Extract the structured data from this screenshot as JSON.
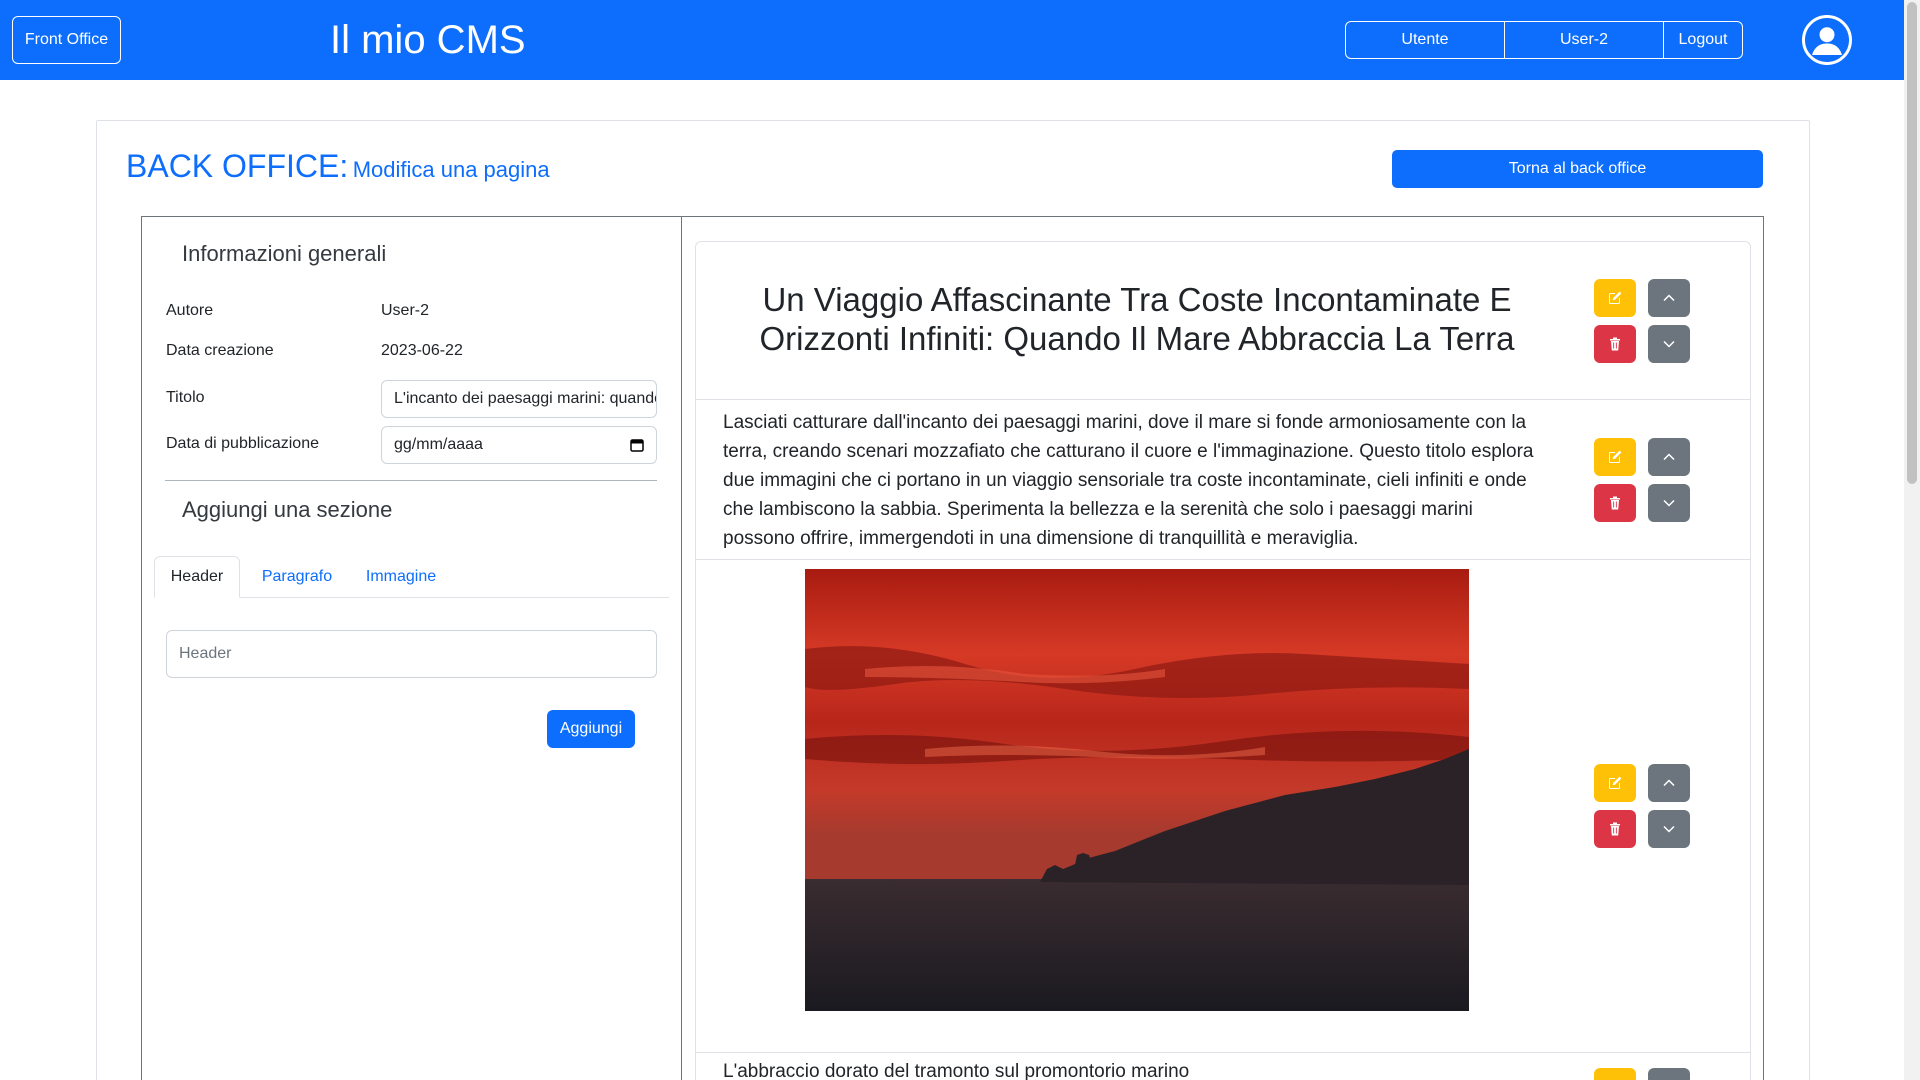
{
  "navbar": {
    "front_office_label": "Front Office",
    "brand": "Il mio CMS",
    "utente_label": "Utente",
    "user_label": "User-2",
    "logout_label": "Logout",
    "avatar_icon": "user-circle-icon"
  },
  "page": {
    "heading_main": "BACK OFFICE:",
    "heading_sub": "Modifica una pagina",
    "back_button_label": "Torna al back office"
  },
  "info": {
    "title": "Informazioni generali",
    "author_label": "Autore",
    "author_value": "User-2",
    "created_label": "Data creazione",
    "created_value": "2023-06-22",
    "title_label": "Titolo",
    "title_value": "L'incanto dei paesaggi marini: quando il mare abbraccia la terra",
    "pubdate_label": "Data di pubblicazione",
    "pubdate_placeholder": "gg/mm/aaaa"
  },
  "add_section": {
    "title": "Aggiungi una sezione",
    "tabs": [
      {
        "label": "Header",
        "active": true
      },
      {
        "label": "Paragrafo",
        "active": false
      },
      {
        "label": "Immagine",
        "active": false
      }
    ],
    "input_placeholder": "Header",
    "add_label": "Aggiungi"
  },
  "preview": {
    "header_text": "Un Viaggio Affascinante Tra Coste Incontaminate E Orizzonti Infiniti: Quando Il Mare Abbraccia La Terra",
    "paragraph_text": "Lasciati catturare dall'incanto dei paesaggi marini, dove il mare si fonde armoniosamente con la terra, creando scenari mozzafiato che catturano il cuore e l'immaginazione. Questo titolo esplora due immagini che ci portano in un viaggio sensoriale tra coste incontaminate, cieli infiniti e onde che lambiscono la sabbia. Sperimenta la bellezza e la serenità che solo i paesaggi marini possono offrire, immergendoti in una dimensione di tranquillità e meraviglia.",
    "image_subject": "sunset-over-sea-promontory",
    "caption_text": "L'abbraccio dorato del tramonto sul promontorio marino"
  },
  "colors": {
    "primary": "#0d6efd",
    "warning": "#ffc107",
    "danger": "#dc3545",
    "secondary": "#6c757d"
  }
}
